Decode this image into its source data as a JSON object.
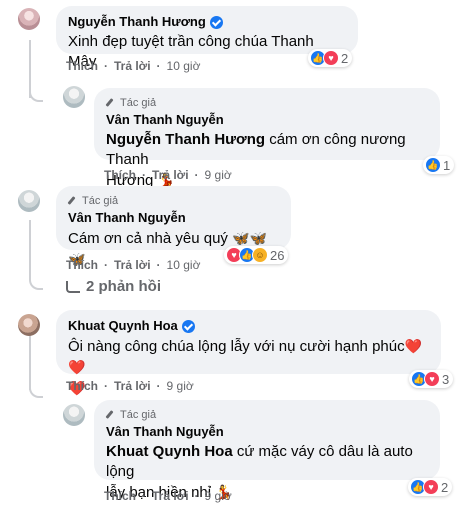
{
  "comments": [
    {
      "name": "Nguyễn Thanh Hương",
      "text": "Xinh đẹp tuyệt trần công chúa Thanh Mây",
      "like": "Thích",
      "reply": "Trả lời",
      "time": "10 giờ",
      "reaction_count": "2"
    },
    {
      "tag": "Tác giả",
      "name": "Vân Thanh Nguyễn",
      "mention": "Nguyễn Thanh Hương",
      "text_line1": " cám ơn công nương Thanh",
      "text_line2": "Hương",
      "emoji": "💃",
      "like": "Thích",
      "reply": "Trả lời",
      "time": "9 giờ",
      "reaction_count": "1"
    },
    {
      "tag": "Tác giả",
      "name": "Vân Thanh Nguyễn",
      "text": "Cám ơn cả nhà yêu quý",
      "emoji": "🦋🦋🦋",
      "like": "Thích",
      "reply": "Trả lời",
      "time": "10 giờ",
      "reaction_count": "26"
    },
    {
      "replies_label": "2 phản hồi"
    },
    {
      "name": "Khuat Quynh Hoa",
      "text_line1": "Ôi nàng công chúa lộng lẫy với nụ cười hạnh phúc",
      "emoji_line1": "❤️❤️",
      "emoji_line2": "❤️",
      "like": "Thích",
      "reply": "Trả lời",
      "time": "9 giờ",
      "reaction_count": "3"
    },
    {
      "tag": "Tác giả",
      "name": "Vân Thanh Nguyễn",
      "mention": "Khuat Quynh Hoa",
      "text_line1": " cứ mặc váy cô dâu là auto lộng",
      "text_line2": "lẫy bạn hiền nhỉ",
      "emoji": "💃",
      "like": "Thích",
      "reply": "Trả lời",
      "time": "9 giờ",
      "reaction_count": "2"
    }
  ],
  "colors": {
    "bubble": "#f0f2f5",
    "meta": "#65676b",
    "like": "#1877f2",
    "love": "#f33e58"
  }
}
